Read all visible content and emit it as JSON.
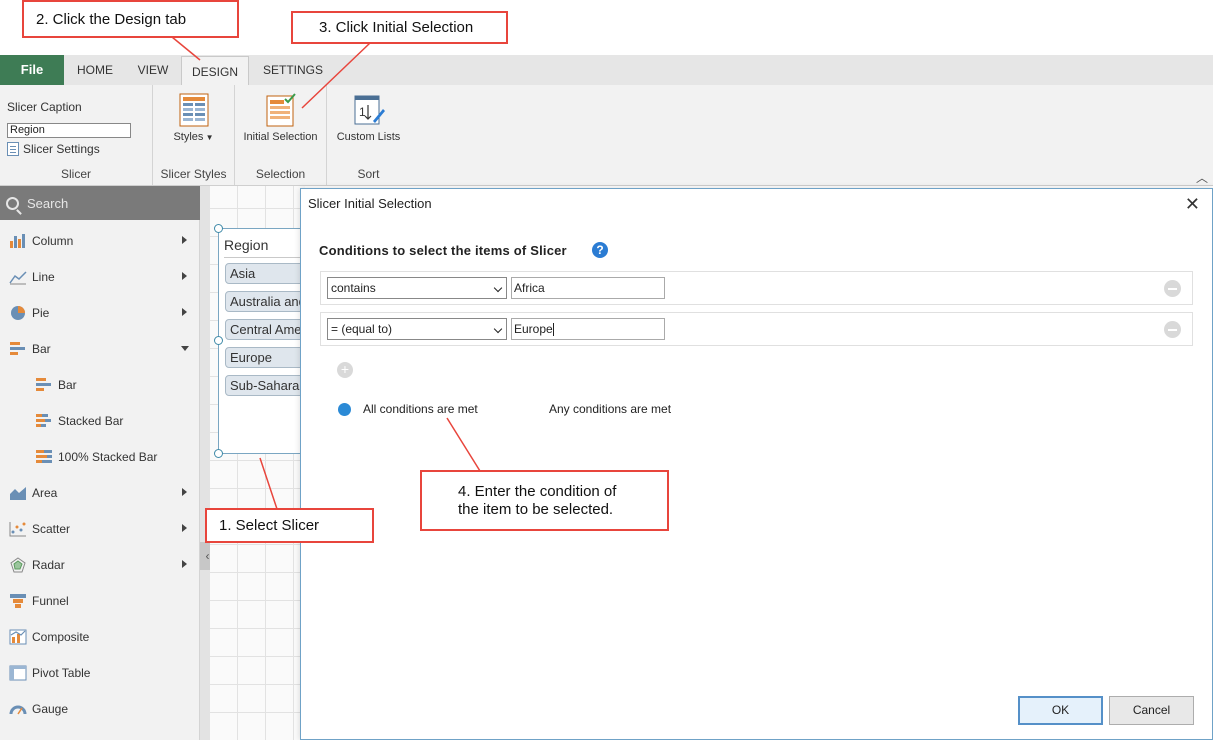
{
  "tabs": {
    "file": "File",
    "home": "HOME",
    "view": "VIEW",
    "design": "DESIGN",
    "settings": "SETTINGS"
  },
  "ribbon": {
    "slicer_caption_label": "Slicer Caption",
    "slicer_caption_value": "Region",
    "slicer_settings": "Slicer Settings",
    "styles": "Styles",
    "initial_selection": "Initial Selection",
    "custom_lists": "Custom Lists",
    "groups": {
      "slicer": "Slicer",
      "slicer_styles": "Slicer Styles",
      "selection": "Selection",
      "sort": "Sort"
    }
  },
  "left_panel": {
    "search_placeholder": "Search",
    "items": [
      {
        "label": "Column",
        "icon": "column-chart-icon"
      },
      {
        "label": "Line",
        "icon": "line-chart-icon"
      },
      {
        "label": "Pie",
        "icon": "pie-chart-icon"
      },
      {
        "label": "Bar",
        "icon": "bar-chart-icon"
      },
      {
        "label": "Bar",
        "icon": "bar-chart-icon"
      },
      {
        "label": "Stacked Bar",
        "icon": "stacked-bar-chart-icon"
      },
      {
        "label": "100% Stacked Bar",
        "icon": "stacked-bar-chart-icon"
      },
      {
        "label": "Area",
        "icon": "area-chart-icon"
      },
      {
        "label": "Scatter",
        "icon": "scatter-chart-icon"
      },
      {
        "label": "Radar",
        "icon": "radar-chart-icon"
      },
      {
        "label": "Funnel",
        "icon": "funnel-chart-icon"
      },
      {
        "label": "Composite",
        "icon": "composite-chart-icon"
      },
      {
        "label": "Pivot Table",
        "icon": "pivot-table-icon"
      },
      {
        "label": "Gauge",
        "icon": "gauge-icon"
      }
    ]
  },
  "slicer": {
    "title": "Region",
    "items": [
      "Asia",
      "Australia and Oceania",
      "Central America",
      "Europe",
      "Sub-Saharan Africa"
    ]
  },
  "dialog": {
    "title": "Slicer Initial Selection",
    "heading": "Conditions to select the items of Slicer",
    "conditions": [
      {
        "operator": "contains",
        "value": "Africa"
      },
      {
        "operator": "= (equal to)",
        "value": "Europe"
      }
    ],
    "match_all": "All conditions are met",
    "match_any": "Any conditions are met",
    "ok": "OK",
    "cancel": "Cancel"
  },
  "callouts": {
    "step1": "1. Select Slicer",
    "step2": "2. Click the Design tab",
    "step3": "3. Click Initial Selection",
    "step4": "4. Enter the condition of\nthe item to be selected."
  },
  "colors": {
    "file_tab": "#3e7c55",
    "accent": "#2b8ad6",
    "callout_border": "#e8453c"
  }
}
